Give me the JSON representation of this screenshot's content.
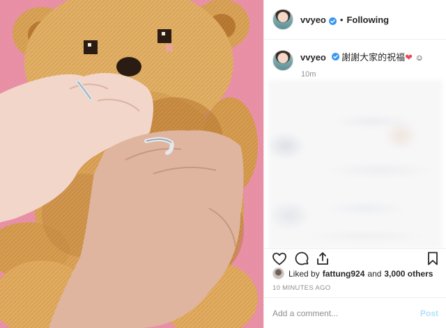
{
  "post": {
    "username": "vvyeo",
    "follow_status": "Following",
    "separator": "•",
    "caption_text": "謝謝大家的祝福",
    "caption_emoji": "❤",
    "caption_extra": "☺",
    "time_short": "10m",
    "liked_prefix": "Liked by",
    "liked_user": "fattung924",
    "liked_and": "and",
    "liked_others": "3,000 others",
    "time_ago": "10 MINUTES AGO",
    "comment_placeholder": "Add a comment...",
    "post_label": "Post"
  },
  "icons": {
    "verified": "verified-badge-icon",
    "like": "heart-icon",
    "comment": "comment-bubble-icon",
    "share": "share-icon",
    "save": "bookmark-icon"
  },
  "colors": {
    "verified_blue": "#3897f0",
    "heart_red": "#ed4956",
    "link_blue_disabled": "#b2dffc"
  }
}
